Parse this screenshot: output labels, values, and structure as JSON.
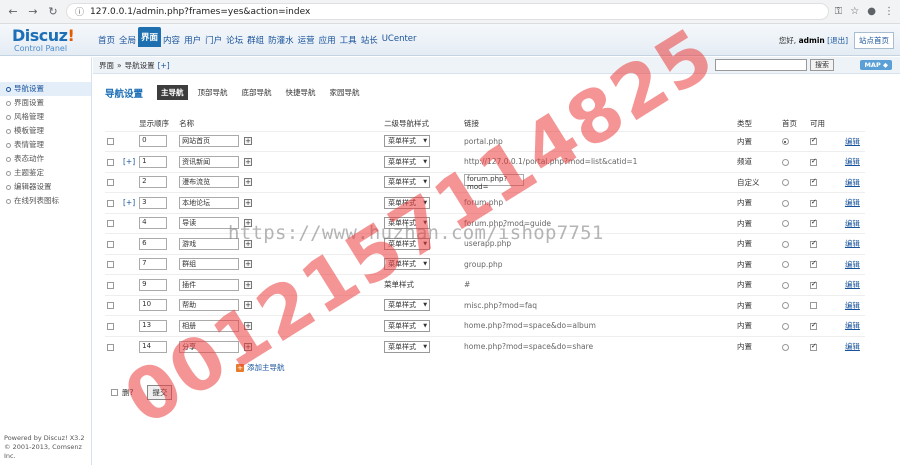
{
  "browser": {
    "url": "127.0.0.1/admin.php?frames=yes&action=index"
  },
  "header": {
    "logo_main": "Discuz",
    "logo_exclaim": "!",
    "logo_sub": "Control Panel",
    "nav": [
      "首页",
      "全局",
      "界面",
      "内容",
      "用户",
      "门户",
      "论坛",
      "群组",
      "防灌水",
      "运营",
      "应用",
      "工具",
      "站长",
      "UCenter"
    ],
    "active_nav": "界面",
    "greeting": "您好,",
    "username": "admin",
    "logout": "[退出]",
    "site_home": "站点首页"
  },
  "sidebar": {
    "items": [
      "导航设置",
      "界面设置",
      "风格管理",
      "模板管理",
      "表情管理",
      "表态动作",
      "主题鉴定",
      "编辑器设置",
      "在线列表图标"
    ],
    "active": "导航设置",
    "footer_line1": "Powered by Discuz! X3.2",
    "footer_line2": "© 2001-2013, Comsenz Inc."
  },
  "crumb": {
    "section": "界面",
    "sep": "»",
    "page": "导航设置",
    "plus": "[+]",
    "search_button": "搜索",
    "map_button": "MAP ◆"
  },
  "tabs": {
    "title": "导航设置",
    "items": [
      "主导航",
      "顶部导航",
      "底部导航",
      "快捷导航",
      "家园导航"
    ],
    "active": "主导航"
  },
  "table": {
    "headers": {
      "order": "显示顺序",
      "name": "名称",
      "style": "二级导航样式",
      "link": "链接",
      "type": "类型",
      "home": "首页",
      "avail": "可用"
    },
    "rows": [
      {
        "expand": "",
        "order": "0",
        "name": "网站首页",
        "plus": true,
        "style": "菜单样式",
        "style_select": true,
        "link": "portal.php",
        "link_input": false,
        "type": "内置",
        "home": true,
        "avail": true,
        "edit": "编辑"
      },
      {
        "expand": "[+]",
        "order": "1",
        "name": "资讯新闻",
        "plus": true,
        "style": "菜单样式",
        "style_select": true,
        "link": "http://127.0.0.1/portal.php?mod=list&catid=1",
        "link_input": false,
        "type": "频道",
        "home": false,
        "avail": true,
        "edit": "编辑"
      },
      {
        "expand": "",
        "order": "2",
        "name": "漫布流览",
        "plus": true,
        "style": "菜单样式",
        "style_select": true,
        "link": "forum.php?mod=",
        "link_input": true,
        "type": "自定义",
        "home": false,
        "avail": true,
        "edit": "编辑"
      },
      {
        "expand": "[+]",
        "order": "3",
        "name": "本地论坛",
        "plus": true,
        "style": "菜单样式",
        "style_select": true,
        "link": "forum.php",
        "link_input": false,
        "type": "内置",
        "home": false,
        "avail": true,
        "edit": "编辑"
      },
      {
        "expand": "",
        "order": "4",
        "name": "导读",
        "plus": true,
        "style": "菜单样式",
        "style_select": true,
        "link": "forum.php?mod=guide",
        "link_input": false,
        "type": "内置",
        "home": false,
        "avail": true,
        "edit": "编辑"
      },
      {
        "expand": "",
        "order": "6",
        "name": "游戏",
        "plus": true,
        "style": "菜单样式",
        "style_select": true,
        "link": "userapp.php",
        "link_input": false,
        "type": "内置",
        "home": false,
        "avail": true,
        "edit": "编辑"
      },
      {
        "expand": "",
        "order": "7",
        "name": "群组",
        "plus": true,
        "style": "菜单样式",
        "style_select": true,
        "link": "group.php",
        "link_input": false,
        "type": "内置",
        "home": false,
        "avail": true,
        "edit": "编辑"
      },
      {
        "expand": "",
        "order": "9",
        "name": "插件",
        "plus": true,
        "style": "菜单样式",
        "style_select": false,
        "link": "#",
        "link_input": false,
        "type": "内置",
        "home": false,
        "avail": true,
        "edit": "编辑"
      },
      {
        "expand": "",
        "order": "10",
        "name": "帮助",
        "plus": true,
        "style": "菜单样式",
        "style_select": true,
        "link": "misc.php?mod=faq",
        "link_input": false,
        "type": "内置",
        "home": false,
        "avail": false,
        "edit": "编辑"
      },
      {
        "expand": "",
        "order": "13",
        "name": "相册",
        "plus": true,
        "style": "菜单样式",
        "style_select": true,
        "link": "home.php?mod=space&do=album",
        "link_input": false,
        "type": "内置",
        "home": false,
        "avail": true,
        "edit": "编辑"
      },
      {
        "expand": "",
        "order": "14",
        "name": "分享",
        "plus": true,
        "style": "菜单样式",
        "style_select": true,
        "link": "home.php?mod=space&do=share",
        "link_input": false,
        "type": "内置",
        "home": false,
        "avail": true,
        "edit": "编辑"
      }
    ]
  },
  "add_nav": "添加主导航",
  "bottom": {
    "delete_label": "删?",
    "submit": "提交"
  },
  "watermark": {
    "url": "https://www.huzhan.com/ishop7751",
    "number": "0012157114825"
  }
}
